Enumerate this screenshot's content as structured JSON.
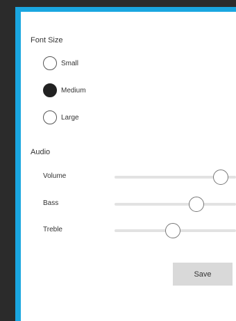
{
  "font_size": {
    "title": "Font Size",
    "options": [
      {
        "label": "Small",
        "selected": false
      },
      {
        "label": "Medium",
        "selected": true
      },
      {
        "label": "Large",
        "selected": false
      }
    ]
  },
  "audio": {
    "title": "Audio",
    "sliders": [
      {
        "label": "Volume",
        "value_fraction": 0.93
      },
      {
        "label": "Bass",
        "value_fraction": 0.7
      },
      {
        "label": "Treble",
        "value_fraction": 0.48
      }
    ]
  },
  "actions": {
    "save_label": "Save"
  },
  "colors": {
    "frame_accent": "#1aa6e0",
    "background": "#2b2b2b",
    "panel": "#ffffff",
    "button": "#d9d9d9"
  }
}
